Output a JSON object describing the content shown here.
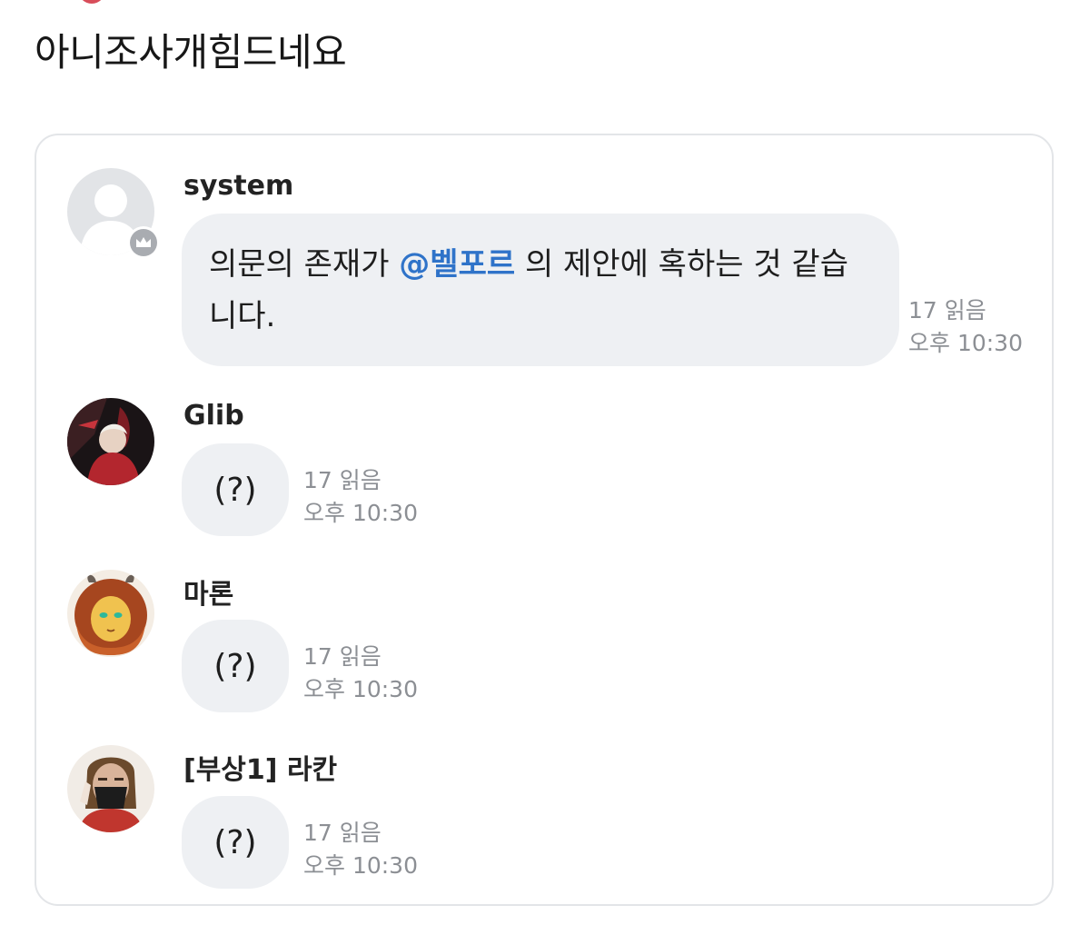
{
  "post": {
    "title": "아니조사개힘드네요"
  },
  "messages": [
    {
      "sender": "system",
      "text_before": "의문의 존재가 ",
      "mention": "@벨포르",
      "text_after": " 의 제안에 혹하는 것 같습니다.",
      "read_count": "17 읽음",
      "time": "오후 10:30",
      "badge_icon": "crown-icon"
    },
    {
      "sender": "Glib",
      "text": "(?)",
      "read_count": "17 읽음",
      "time": "오후 10:30"
    },
    {
      "sender": "마론",
      "text": "(?)",
      "read_count": "17 읽음",
      "time": "오후 10:30"
    },
    {
      "sender": "[부상1] 라칸",
      "text": "(?)",
      "read_count": "17 읽음",
      "time": "오후 10:30"
    }
  ],
  "colors": {
    "bubble": "#eef0f3",
    "mention": "#2f73c9",
    "meta_text": "#8c8f94",
    "card_border": "#e3e5e8"
  }
}
